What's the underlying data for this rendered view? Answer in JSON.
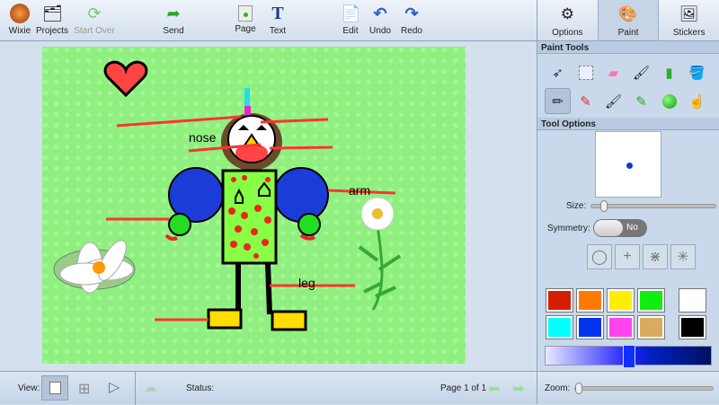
{
  "toolbar": {
    "wixie": "Wixie",
    "projects": "Projects",
    "start_over": "Start Over",
    "send": "Send",
    "page": "Page",
    "text": "Text",
    "edit": "Edit",
    "undo": "Undo",
    "redo": "Redo"
  },
  "tabs": {
    "options": "Options",
    "paint": "Paint",
    "stickers": "Stickers"
  },
  "paint_tools_title": "Paint Tools",
  "tool_options_title": "Tool Options",
  "size_label": "Size:",
  "size_value": 0.1,
  "symmetry_label": "Symmetry:",
  "symmetry_value": "No",
  "swatches": [
    "#d42000",
    "#ff7a00",
    "#ffee00",
    "#10ee10",
    "#ffffff",
    "#00ffff",
    "#0033ee",
    "#ff44ee",
    "#d9aa5f",
    "#000000"
  ],
  "selected_color": "#1433d6",
  "zoom_label": "Zoom:",
  "zoom_value": 0,
  "bottom": {
    "view_label": "View:",
    "status_label": "Status:",
    "page_info": "Page 1 of 1"
  },
  "canvas": {
    "labels": {
      "nose": "nose",
      "arm": "arm",
      "leg": "leg"
    }
  }
}
